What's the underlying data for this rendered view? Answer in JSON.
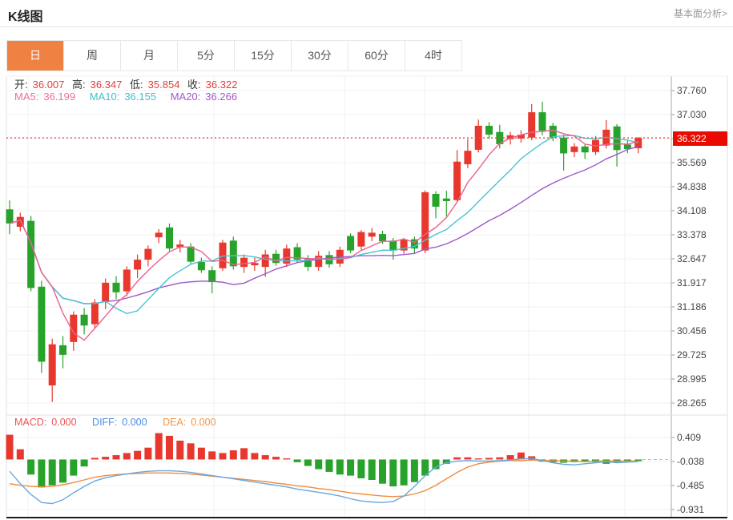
{
  "header": {
    "title": "K线图",
    "link": "基本面分析>"
  },
  "tabs": {
    "items": [
      "日",
      "周",
      "月",
      "5分",
      "15分",
      "30分",
      "60分",
      "4时"
    ],
    "active_index": 0
  },
  "legend": {
    "open_label": "开:",
    "open": "36.007",
    "high_label": "高:",
    "high": "36.347",
    "low_label": "低:",
    "low": "35.854",
    "close_label": "收:",
    "close": "36.322",
    "ma5_label": "MA5:",
    "ma5": "36.199",
    "ma10_label": "MA10:",
    "ma10": "36.155",
    "ma20_label": "MA20:",
    "ma20": "36.266"
  },
  "macd_legend": {
    "macd_label": "MACD:",
    "macd": "0.000",
    "diff_label": "DIFF:",
    "diff": "0.000",
    "dea_label": "DEA:",
    "dea": "0.000"
  },
  "colors": {
    "up": "#e8382d",
    "down": "#27a22b",
    "ma5": "#ec6090",
    "ma10": "#45c5d2",
    "ma20": "#9e59c8",
    "diff_line": "#6aa7e0",
    "dea_line": "#ef8d3e",
    "grid": "#f0f0f0",
    "vgrid": "#f2f2f2",
    "axis": "#aaaaaa",
    "dotted_price": "#ff4545",
    "badge_bg": "#ea0b00",
    "tab_active_bg": "#ef8143",
    "dashed_zero": "#8fd3e8",
    "frame_bottom": "#1a1a1a"
  },
  "chart_data": [
    {
      "type": "candlestick",
      "title": "K线图 日K",
      "period_selected": "日",
      "current_price": 36.322,
      "current_price_label": "36.322",
      "ylim": [
        28.265,
        37.76
      ],
      "y_axis_labels": [
        "37.760",
        "37.030",
        "",
        "35.569",
        "34.838",
        "34.108",
        "33.378",
        "32.647",
        "31.917",
        "31.186",
        "30.456",
        "29.725",
        "28.995",
        "28.265"
      ],
      "ohlc_today": {
        "open": 36.007,
        "high": 36.347,
        "low": 35.854,
        "close": 36.322
      },
      "ma_values": {
        "ma5": 36.199,
        "ma10": 36.155,
        "ma20": 36.266
      },
      "ma_periods": [
        5,
        10,
        20
      ],
      "candles": [
        [
          34.15,
          34.42,
          33.4,
          33.72
        ],
        [
          33.62,
          34.05,
          33.48,
          33.92
        ],
        [
          33.8,
          33.95,
          31.66,
          31.76
        ],
        [
          31.8,
          31.98,
          29.18,
          29.52
        ],
        [
          28.8,
          30.22,
          28.3,
          30.05
        ],
        [
          30.02,
          30.3,
          29.32,
          29.73
        ],
        [
          30.12,
          31.05,
          29.85,
          30.95
        ],
        [
          30.95,
          31.15,
          30.35,
          30.62
        ],
        [
          30.66,
          31.42,
          30.52,
          31.32
        ],
        [
          31.34,
          32.05,
          31.12,
          31.92
        ],
        [
          31.92,
          32.12,
          31.42,
          31.63
        ],
        [
          31.66,
          32.42,
          31.52,
          32.32
        ],
        [
          32.32,
          32.78,
          32.06,
          32.62
        ],
        [
          32.62,
          33.05,
          32.42,
          32.95
        ],
        [
          33.3,
          33.55,
          33.12,
          33.44
        ],
        [
          33.6,
          33.72,
          32.88,
          32.96
        ],
        [
          33.0,
          33.22,
          32.84,
          33.08
        ],
        [
          33.02,
          33.12,
          32.5,
          32.56
        ],
        [
          32.55,
          32.68,
          32.22,
          32.3
        ],
        [
          32.3,
          32.42,
          31.6,
          31.94
        ],
        [
          32.36,
          33.22,
          32.28,
          33.14
        ],
        [
          33.2,
          33.32,
          32.32,
          32.42
        ],
        [
          32.4,
          32.78,
          32.22,
          32.68
        ],
        [
          32.45,
          32.68,
          32.28,
          32.52
        ],
        [
          32.4,
          32.92,
          32.1,
          32.78
        ],
        [
          32.8,
          32.92,
          32.44,
          32.52
        ],
        [
          32.5,
          33.08,
          32.4,
          32.96
        ],
        [
          33.0,
          33.12,
          32.52,
          32.62
        ],
        [
          32.64,
          32.76,
          32.28,
          32.4
        ],
        [
          32.4,
          32.88,
          32.28,
          32.74
        ],
        [
          32.76,
          32.88,
          32.38,
          32.48
        ],
        [
          32.5,
          33.02,
          32.4,
          32.92
        ],
        [
          33.34,
          33.42,
          32.82,
          32.9
        ],
        [
          33.02,
          33.52,
          32.92,
          33.46
        ],
        [
          33.32,
          33.58,
          33.18,
          33.44
        ],
        [
          33.4,
          33.5,
          33.1,
          33.18
        ],
        [
          33.2,
          33.28,
          32.62,
          32.9
        ],
        [
          32.9,
          33.28,
          32.8,
          33.24
        ],
        [
          33.24,
          33.32,
          32.8,
          32.96
        ],
        [
          32.9,
          34.72,
          32.82,
          34.67
        ],
        [
          34.62,
          34.7,
          33.88,
          34.23
        ],
        [
          34.48,
          34.72,
          33.94,
          34.4
        ],
        [
          34.43,
          35.95,
          34.38,
          35.6
        ],
        [
          35.52,
          36.28,
          35.4,
          35.93
        ],
        [
          35.96,
          36.88,
          35.88,
          36.69
        ],
        [
          36.69,
          36.8,
          36.3,
          36.42
        ],
        [
          36.5,
          36.72,
          36.0,
          36.13
        ],
        [
          36.28,
          36.5,
          36.12,
          36.4
        ],
        [
          36.3,
          36.55,
          36.18,
          36.42
        ],
        [
          36.33,
          37.35,
          36.25,
          37.1
        ],
        [
          37.1,
          37.42,
          36.4,
          36.54
        ],
        [
          36.69,
          36.78,
          36.22,
          36.33
        ],
        [
          36.33,
          36.42,
          35.33,
          35.85
        ],
        [
          35.89,
          36.16,
          35.74,
          36.06
        ],
        [
          36.06,
          36.14,
          35.68,
          35.88
        ],
        [
          35.89,
          36.38,
          35.8,
          36.26
        ],
        [
          36.09,
          36.86,
          36.0,
          36.57
        ],
        [
          36.67,
          36.74,
          35.45,
          35.95
        ],
        [
          36.12,
          36.24,
          35.86,
          35.98
        ],
        [
          36.007,
          36.347,
          35.854,
          36.322
        ]
      ]
    },
    {
      "type": "bar",
      "title": "MACD",
      "values_displayed": {
        "macd": 0.0,
        "diff": 0.0,
        "dea": 0.0
      },
      "ylim": [
        -0.97,
        0.45
      ],
      "y_axis_labels": [
        "0.409",
        "-0.038",
        "-0.485",
        "-0.931"
      ],
      "histogram": [
        0.46,
        0.19,
        -0.28,
        -0.52,
        -0.48,
        -0.43,
        -0.3,
        -0.13,
        0.03,
        0.05,
        0.08,
        0.12,
        0.16,
        0.22,
        0.49,
        0.44,
        0.35,
        0.3,
        0.22,
        0.15,
        0.12,
        0.17,
        0.21,
        0.12,
        0.08,
        0.05,
        0.02,
        -0.05,
        -0.12,
        -0.18,
        -0.23,
        -0.28,
        -0.3,
        -0.35,
        -0.38,
        -0.45,
        -0.5,
        -0.48,
        -0.42,
        -0.3,
        -0.18,
        -0.08,
        0.04,
        0.04,
        0.02,
        0.03,
        0.04,
        0.08,
        0.13,
        0.06,
        -0.04,
        -0.05,
        -0.06,
        -0.05,
        -0.04,
        -0.05,
        -0.08,
        -0.05,
        -0.04,
        -0.03
      ],
      "diff": [
        -0.22,
        -0.45,
        -0.65,
        -0.8,
        -0.82,
        -0.75,
        -0.62,
        -0.5,
        -0.4,
        -0.34,
        -0.3,
        -0.27,
        -0.24,
        -0.22,
        -0.21,
        -0.21,
        -0.22,
        -0.24,
        -0.27,
        -0.3,
        -0.33,
        -0.36,
        -0.39,
        -0.42,
        -0.45,
        -0.48,
        -0.51,
        -0.55,
        -0.58,
        -0.61,
        -0.64,
        -0.68,
        -0.73,
        -0.77,
        -0.79,
        -0.8,
        -0.78,
        -0.68,
        -0.5,
        -0.3,
        -0.14,
        -0.06,
        -0.03,
        -0.02,
        -0.03,
        -0.03,
        -0.02,
        -0.01,
        0.01,
        0.02,
        -0.02,
        -0.06,
        -0.09,
        -0.1,
        -0.08,
        -0.06,
        -0.04,
        -0.06,
        -0.05,
        -0.04
      ],
      "dea": [
        -0.45,
        -0.48,
        -0.5,
        -0.51,
        -0.5,
        -0.47,
        -0.43,
        -0.38,
        -0.33,
        -0.3,
        -0.28,
        -0.27,
        -0.26,
        -0.25,
        -0.25,
        -0.25,
        -0.26,
        -0.27,
        -0.29,
        -0.31,
        -0.33,
        -0.35,
        -0.37,
        -0.39,
        -0.41,
        -0.44,
        -0.46,
        -0.49,
        -0.51,
        -0.54,
        -0.56,
        -0.59,
        -0.62,
        -0.64,
        -0.66,
        -0.68,
        -0.69,
        -0.68,
        -0.64,
        -0.58,
        -0.48,
        -0.36,
        -0.24,
        -0.14,
        -0.08,
        -0.05,
        -0.03,
        -0.02,
        -0.02,
        -0.01,
        -0.02,
        -0.02,
        -0.03,
        -0.03,
        -0.04,
        -0.03,
        -0.03,
        -0.03,
        -0.03,
        -0.03
      ]
    }
  ]
}
